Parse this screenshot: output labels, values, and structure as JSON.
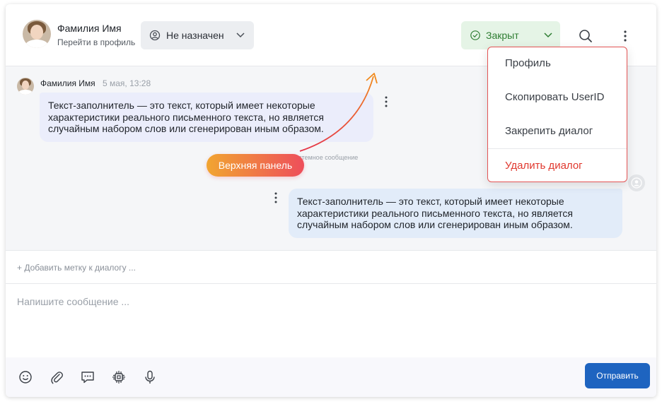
{
  "header": {
    "user_name": "Фамилия Имя",
    "profile_link": "Перейти в профиль",
    "assignee": "Не назначен",
    "status": "Закрыт"
  },
  "colors": {
    "status_green": "#2e7d32",
    "accent_blue": "#1e64c0",
    "danger_red": "#e0382e",
    "gradient_start": "#f1a531",
    "gradient_end": "#ee4e5b"
  },
  "messages": [
    {
      "author": "Фамилия Имя",
      "time": "5 мая, 13:28",
      "text": "Текст-заполнитель — это текст, который имеет некоторые характеристики реального письменного текста, но является случайным набором слов или сгенерирован иным образом."
    },
    {
      "text": "Текст-заполнитель — это текст, который имеет некоторые характеристики реального письменного текста, но является случайным набором слов или сгенерирован иным образом."
    }
  ],
  "system_message": "стемное сообщение",
  "annotation_pill": "Верхняя панель",
  "label_add": "+ Добавить метку к диалогу ...",
  "composer": {
    "placeholder": "Напишите сообщение ...",
    "send": "Отправить"
  },
  "menu": {
    "items": [
      "Профиль",
      "Скопировать UserID",
      "Закрепить диалог",
      "Удалить диалог"
    ]
  },
  "icons": {
    "toolbar": [
      "smile-icon",
      "paperclip-icon",
      "quick-reply-icon",
      "bot-icon",
      "microphone-icon"
    ]
  }
}
